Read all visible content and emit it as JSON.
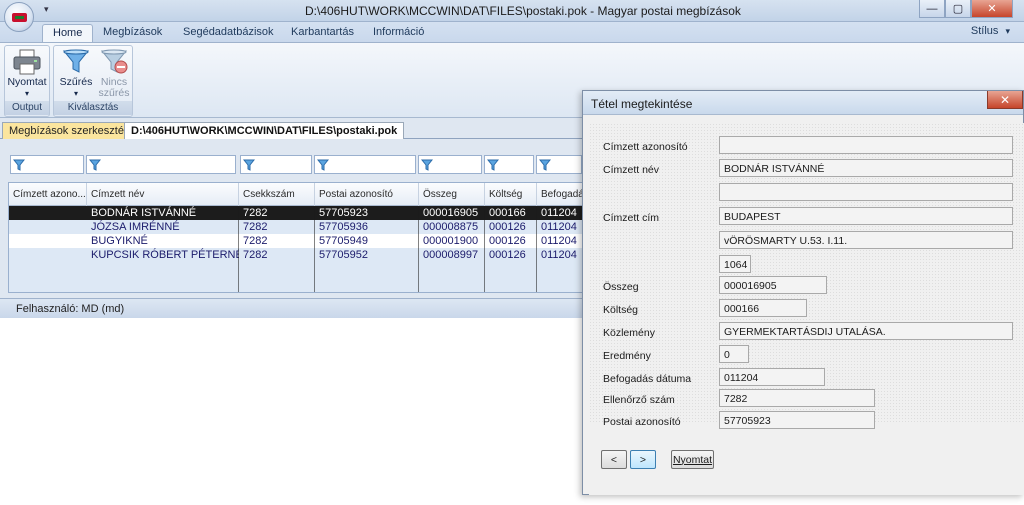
{
  "window": {
    "title": "D:\\406HUT\\WORK\\MCCWIN\\DAT\\FILES\\postaki.pok - Magyar postai megbízások",
    "qa_arrow": "▾",
    "minimize": "—",
    "maximize": "▢",
    "close": "✕"
  },
  "ribbon": {
    "tabs": [
      "Home",
      "Megbízások",
      "Segédadatbázisok",
      "Karbantartás",
      "Információ"
    ],
    "style_label": "Stílus",
    "style_arrow": "▾",
    "groups": {
      "output": {
        "label": "Output",
        "print_label": "Nyomtat",
        "print_arrow": "▾"
      },
      "selection": {
        "label": "Kiválasztás",
        "filter_label": "Szűrés",
        "filter_arrow": "▾",
        "nofilter_label_1": "Nincs",
        "nofilter_label_2": "szűrés"
      }
    }
  },
  "doc_tabs": [
    "Megbízások szerkesztése",
    "D:\\406HUT\\WORK\\MCCWIN\\DAT\\FILES\\postaki.pok"
  ],
  "grid": {
    "columns": [
      "Címzett azono...",
      "Címzett név",
      "Csekkszám",
      "Postai azonosító",
      "Összeg",
      "Költség",
      "Befogadás"
    ],
    "rows": [
      [
        "",
        "BODNÁR ISTVÁNNÉ",
        "7282",
        "57705923",
        "000016905",
        "000166",
        "011204"
      ],
      [
        "",
        "JÓZSA IMRÉNNÉ",
        "7282",
        "57705936",
        "000008875",
        "000126",
        "011204"
      ],
      [
        "",
        "BUGYIKNÉ",
        "7282",
        "57705949",
        "000001900",
        "000126",
        "011204"
      ],
      [
        "",
        "KUPCSIK RÓBERT PÉTERNÉ",
        "7282",
        "57705952",
        "000008997",
        "000126",
        "011204"
      ]
    ]
  },
  "status": {
    "text": "Felhasználó: MD (md)"
  },
  "dialog": {
    "title": "Tétel megtekintése",
    "close": "✕",
    "fields": {
      "cimzett_azonosito": {
        "label": "Címzett azonosító",
        "value": ""
      },
      "cimzett_nev": {
        "label": "Címzett név",
        "value": "BODNÁR ISTVÁNNÉ"
      },
      "cimzett_nev2": {
        "value": ""
      },
      "cimzett_cim": {
        "label": "Címzett cím",
        "value": "BUDAPEST"
      },
      "utca": {
        "value": "vÖRÖSMARTY U.53. I.11."
      },
      "irsz": {
        "value": "1064"
      },
      "osszeg": {
        "label": "Összeg",
        "value": "000016905"
      },
      "koltseg": {
        "label": "Költség",
        "value": "000166"
      },
      "kozlemeny": {
        "label": "Közlemény",
        "value": "GYERMEKTARTÁSDIJ  UTALÁSA."
      },
      "eredmeny": {
        "label": "Eredmény",
        "value": "0"
      },
      "befogadas": {
        "label": "Befogadás dátuma",
        "value": "011204"
      },
      "ellenorzo": {
        "label": "Ellenőrző szám",
        "value": "7282"
      },
      "postai": {
        "label": "Postai azonosító",
        "value": "57705923"
      }
    },
    "prev": "<",
    "next": ">",
    "print": "Nyomtat"
  }
}
